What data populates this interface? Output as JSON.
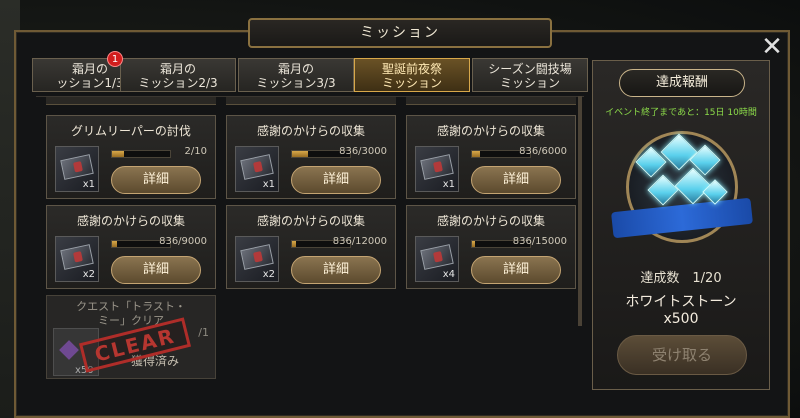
{
  "window": {
    "title": "ミッション",
    "close_label": "✕"
  },
  "tabs": [
    {
      "line1": "霜月の",
      "line2": "ッション1/3",
      "active": false,
      "badge": "1"
    },
    {
      "line1": "霜月の",
      "line2": "ミッション2/3",
      "active": false
    },
    {
      "line1": "霜月の",
      "line2": "ミッション3/3",
      "active": false
    },
    {
      "line1": "聖誕前夜祭",
      "line2": "ミッション",
      "active": true
    },
    {
      "line1": "シーズン闘技場",
      "line2": "ミッション",
      "active": false
    }
  ],
  "missions": [
    {
      "title": "グリムリーパーの討伐",
      "progress": "2/10",
      "fraction": 0.2,
      "qty": "x1",
      "button": "詳細"
    },
    {
      "title": "感謝のかけらの収集",
      "progress": "836/3000",
      "fraction": 0.279,
      "qty": "x1",
      "button": "詳細"
    },
    {
      "title": "感謝のかけらの収集",
      "progress": "836/6000",
      "fraction": 0.139,
      "qty": "x1",
      "button": "詳細"
    },
    {
      "title": "感謝のかけらの収集",
      "progress": "836/9000",
      "fraction": 0.093,
      "qty": "x2",
      "button": "詳細"
    },
    {
      "title": "感謝のかけらの収集",
      "progress": "836/12000",
      "fraction": 0.07,
      "qty": "x2",
      "button": "詳細"
    },
    {
      "title": "感謝のかけらの収集",
      "progress": "836/15000",
      "fraction": 0.056,
      "qty": "x4",
      "button": "詳細"
    }
  ],
  "completed_mission": {
    "title_line1": "クエスト「トラスト・",
    "title_line2": "ミー」クリア",
    "progress": "/1",
    "qty": "x50",
    "status": "獲得済み",
    "stamp": "CLEAR"
  },
  "side_panel": {
    "title": "達成報酬",
    "countdown": "イベント終了まであと：15日 10時間",
    "achievement": "達成数　1/20",
    "reward_name": "ホワイトストーン",
    "reward_qty": "x500",
    "receive_button": "受け取る"
  }
}
